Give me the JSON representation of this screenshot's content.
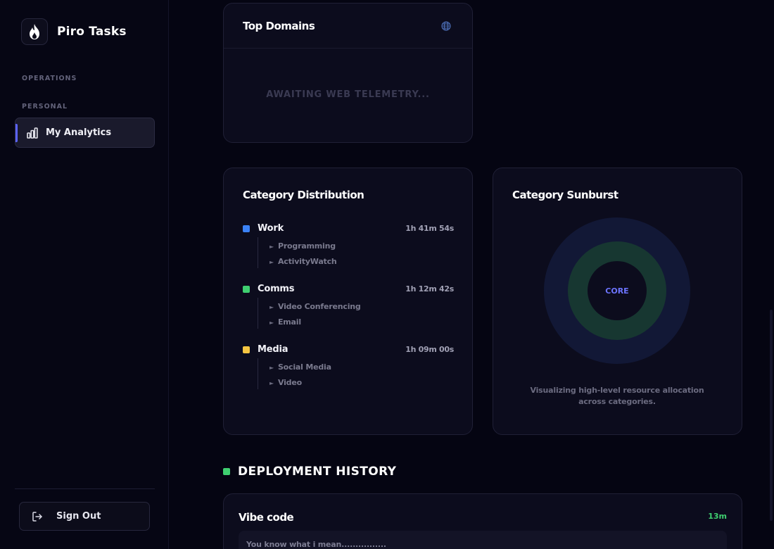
{
  "app": {
    "name": "Piro Tasks"
  },
  "sidebar": {
    "sections": {
      "operations": "OPERATIONS",
      "personal": "PERSONAL"
    },
    "active_item": {
      "label": "My Analytics",
      "icon": "bar-chart-icon"
    },
    "sign_out": {
      "label": "Sign Out",
      "icon": "logout-icon"
    }
  },
  "top_domains": {
    "title": "Top Domains",
    "icon": "globe-icon",
    "empty_text": "AWAITING WEB TELEMETRY..."
  },
  "category_distribution": {
    "title": "Category Distribution",
    "categories": [
      {
        "name": "Work",
        "time": "1h 41m 54s",
        "color": "#3b82f6",
        "children": [
          "Programming",
          "ActivityWatch"
        ]
      },
      {
        "name": "Comms",
        "time": "1h 12m 42s",
        "color": "#3fcf70",
        "children": [
          "Video Conferencing",
          "Email"
        ]
      },
      {
        "name": "Media",
        "time": "1h 09m 00s",
        "color": "#f5c542",
        "children": [
          "Social Media",
          "Video"
        ]
      }
    ]
  },
  "category_sunburst": {
    "title": "Category Sunburst",
    "center_label": "CORE",
    "caption": "Visualizing high-level resource allocation across categories."
  },
  "deployment_history": {
    "title": "DEPLOYMENT HISTORY",
    "entries": [
      {
        "title": "Vibe code",
        "duration": "13m",
        "note": "You know what i mean................"
      }
    ]
  }
}
